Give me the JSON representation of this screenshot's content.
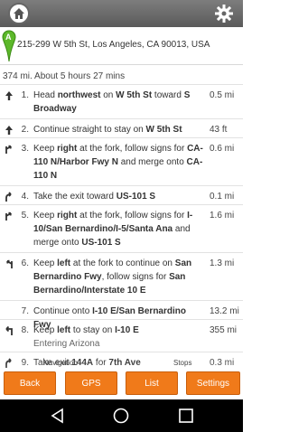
{
  "header": {
    "home_icon": "home-icon",
    "settings_icon": "gear-icon"
  },
  "route": {
    "marker_label": "A",
    "address": "215-299 W 5th St, Los Angeles, CA 90013, USA",
    "summary": "374 mi. About 5 hours 27 mins"
  },
  "steps": [
    {
      "icon": "straight-arrow-icon",
      "num": "1.",
      "parts": [
        [
          "Head ",
          false
        ],
        [
          "northwest",
          true
        ],
        [
          " on ",
          false
        ],
        [
          "W 5th St",
          true
        ],
        [
          " toward ",
          false
        ],
        [
          "S Broadway",
          true
        ]
      ],
      "sub": "",
      "dist": "0.5 mi"
    },
    {
      "icon": "straight-arrow-icon",
      "num": "2.",
      "parts": [
        [
          "Continue straight to stay on ",
          false
        ],
        [
          "W 5th St",
          true
        ]
      ],
      "sub": "",
      "dist": "43 ft"
    },
    {
      "icon": "fork-right-icon",
      "num": "3.",
      "parts": [
        [
          "Keep ",
          false
        ],
        [
          "right",
          true
        ],
        [
          " at the fork, follow signs for ",
          false
        ],
        [
          "CA-110 N/Harbor Fwy N",
          true
        ],
        [
          " and merge onto ",
          false
        ],
        [
          "CA-110 N",
          true
        ]
      ],
      "sub": "",
      "dist": "0.6 mi"
    },
    {
      "icon": "ramp-right-icon",
      "num": "4.",
      "parts": [
        [
          "Take the exit toward ",
          false
        ],
        [
          "US-101 S",
          true
        ]
      ],
      "sub": "",
      "dist": "0.1 mi"
    },
    {
      "icon": "fork-right-icon",
      "num": "5.",
      "parts": [
        [
          "Keep ",
          false
        ],
        [
          "right",
          true
        ],
        [
          " at the fork, follow signs for ",
          false
        ],
        [
          "I-10/San Bernardino/I-5/Santa Ana",
          true
        ],
        [
          " and merge onto ",
          false
        ],
        [
          "US-101 S",
          true
        ]
      ],
      "sub": "",
      "dist": "1.6 mi"
    },
    {
      "icon": "fork-left-icon",
      "num": "6.",
      "parts": [
        [
          "Keep ",
          false
        ],
        [
          "left",
          true
        ],
        [
          " at the fork to continue on ",
          false
        ],
        [
          "San Bernardino Fwy",
          true
        ],
        [
          ", follow signs for ",
          false
        ],
        [
          "San Bernardino/Interstate 10 E",
          true
        ]
      ],
      "sub": "",
      "dist": "1.3 mi"
    },
    {
      "icon": "",
      "num": "7.",
      "parts": [
        [
          "Continue onto ",
          false
        ],
        [
          "I-10 E/San Bernardino Fwy",
          true
        ]
      ],
      "sub": "",
      "dist": "13.2 mi"
    },
    {
      "icon": "keep-left-icon",
      "num": "8.",
      "parts": [
        [
          "Keep ",
          false
        ],
        [
          "left",
          true
        ],
        [
          " to stay on ",
          false
        ],
        [
          "I-10 E",
          true
        ]
      ],
      "sub": "Entering Arizona",
      "dist": "355 mi"
    },
    {
      "icon": "ramp-right-icon",
      "num": "9.",
      "parts": [
        [
          "Take exit ",
          false
        ],
        [
          "144A",
          true
        ],
        [
          " for ",
          false
        ],
        [
          "7th Ave",
          true
        ]
      ],
      "sub": "",
      "dist": "0.3 mi"
    }
  ],
  "bottom": {
    "navigation_label": "Navigation",
    "stops_label": "Stops",
    "back": "Back",
    "gps": "GPS",
    "list": "List",
    "settings": "Settings",
    "accent_color": "#f07a1a"
  },
  "system_nav": {
    "back_icon": "back-triangle-icon",
    "home_icon": "circle-home-icon",
    "recents_icon": "square-recents-icon"
  }
}
